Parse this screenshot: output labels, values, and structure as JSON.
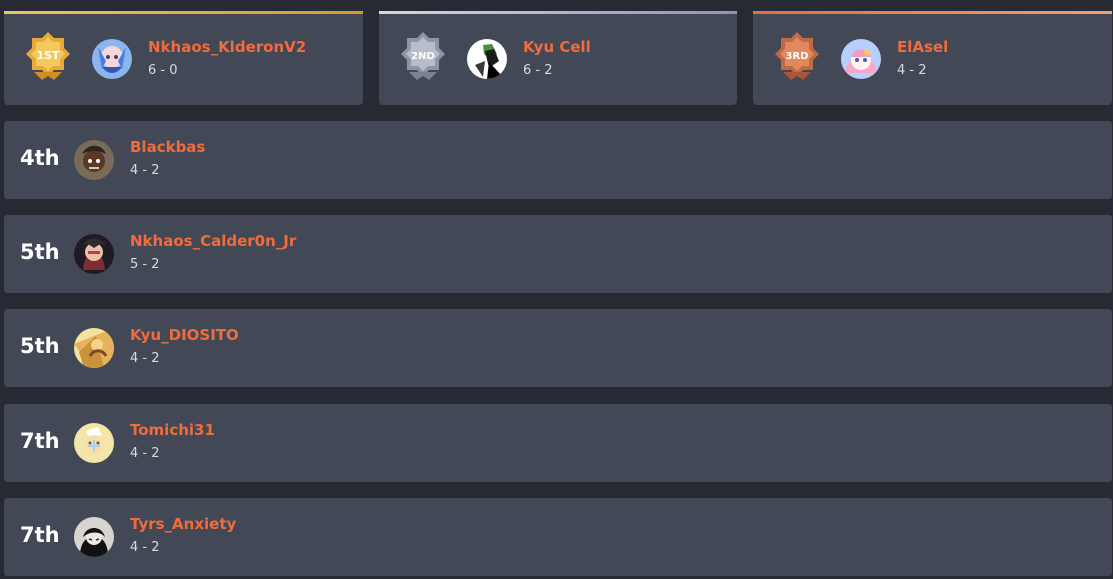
{
  "colors": {
    "gold": "#e8b43a",
    "silver": "#a7adbc",
    "bronze": "#e0875c",
    "name": "#f26b3a",
    "card": "#434857",
    "background": "#272a33"
  },
  "podium": [
    {
      "medal_label": "1ST",
      "name": "Nkhaos_KlderonV2",
      "record": "6 - 0",
      "avatar": "anime-avatar"
    },
    {
      "medal_label": "2ND",
      "name": "Kyu Cell",
      "record": "6 - 2",
      "avatar": "anime-avatar"
    },
    {
      "medal_label": "3RD",
      "name": "ElAsel",
      "record": "4 - 2",
      "avatar": "anime-avatar"
    }
  ],
  "standings": [
    {
      "rank": "4th",
      "name": "Blackbas",
      "record": "4 - 2"
    },
    {
      "rank": "5th",
      "name": "Nkhaos_Calder0n_Jr",
      "record": "5 - 2"
    },
    {
      "rank": "5th",
      "name": "Kyu_DIOSITO",
      "record": "4 - 2"
    },
    {
      "rank": "7th",
      "name": "Tomichi31",
      "record": "4 - 2"
    },
    {
      "rank": "7th",
      "name": "Tyrs_Anxiety",
      "record": "4 - 2"
    }
  ]
}
